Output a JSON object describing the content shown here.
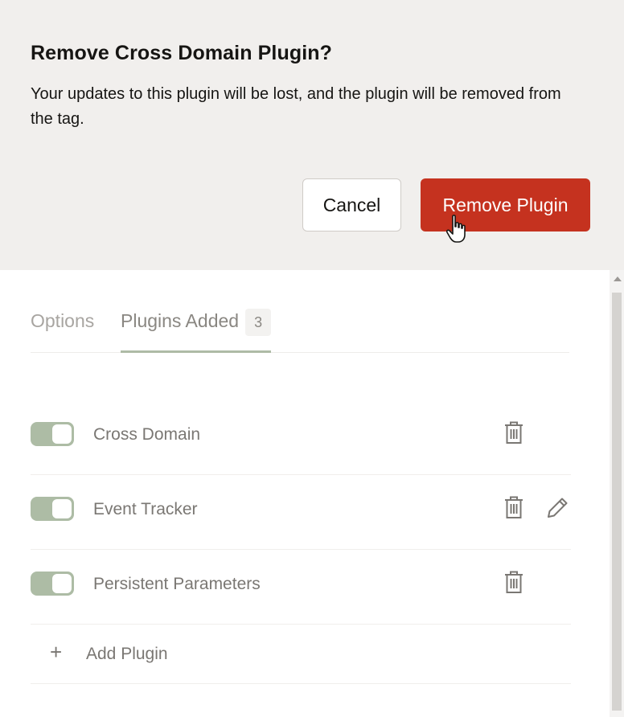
{
  "dialog": {
    "title": "Remove Cross Domain Plugin?",
    "message": "Your updates to this plugin will be lost, and the plugin will be removed from the tag.",
    "cancel_label": "Cancel",
    "confirm_label": "Remove Plugin"
  },
  "tabs": [
    {
      "label": "Options",
      "active": false
    },
    {
      "label": "Plugins Added",
      "active": true,
      "count": "3"
    }
  ],
  "plugins": [
    {
      "name": "Cross Domain",
      "enabled": true,
      "actions": [
        "trash-icon"
      ]
    },
    {
      "name": "Event Tracker",
      "enabled": true,
      "actions": [
        "trash-icon",
        "pencil-icon"
      ]
    },
    {
      "name": "Persistent Parameters",
      "enabled": true,
      "actions": [
        "trash-icon"
      ]
    }
  ],
  "add_plugin": {
    "icon": "plus-icon",
    "label": "Add Plugin"
  },
  "colors": {
    "danger": "#c5321f",
    "toggle_on": "#adbca5",
    "dialog_bg": "#f1efed",
    "muted_text": "#7a7773"
  }
}
